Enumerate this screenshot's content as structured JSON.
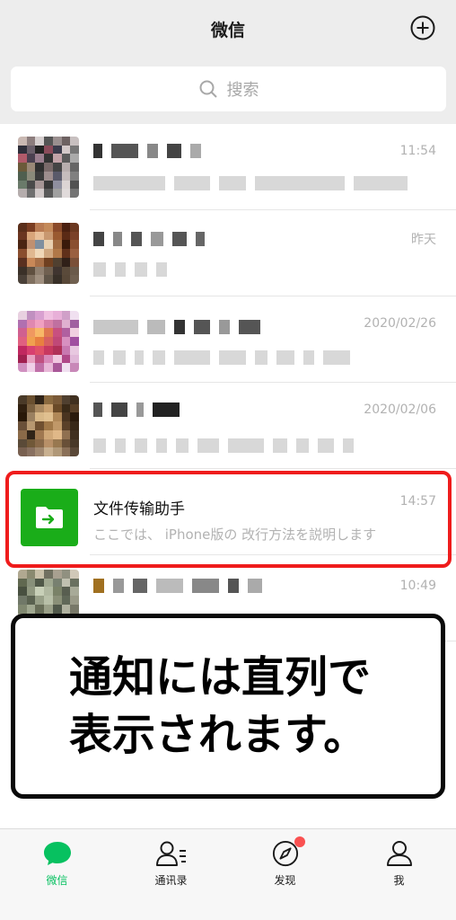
{
  "header": {
    "title": "微信"
  },
  "search": {
    "label": "搜索"
  },
  "chats": [
    {
      "time": "11:54"
    },
    {
      "time": "昨天"
    },
    {
      "time": "2020/02/26"
    },
    {
      "time": "2020/02/06"
    },
    {
      "name": "文件传输助手",
      "preview": "ここでは、 iPhone版の 改行方法を説明します",
      "time": "14:57"
    },
    {
      "time": "10:49"
    }
  ],
  "callout": {
    "lines": [
      "通知には直列で",
      "表示されます。"
    ]
  },
  "tabs": [
    {
      "label": "微信",
      "icon": "chat-icon",
      "active": true
    },
    {
      "label": "通讯录",
      "icon": "contacts-icon"
    },
    {
      "label": "发现",
      "icon": "compass-icon",
      "badge": true
    },
    {
      "label": "我",
      "icon": "person-icon"
    }
  ],
  "colors": {
    "accent": "#07c160",
    "highlight": "#ef1c1c",
    "file_avatar": "#1aad19",
    "badge": "#fa5151"
  }
}
